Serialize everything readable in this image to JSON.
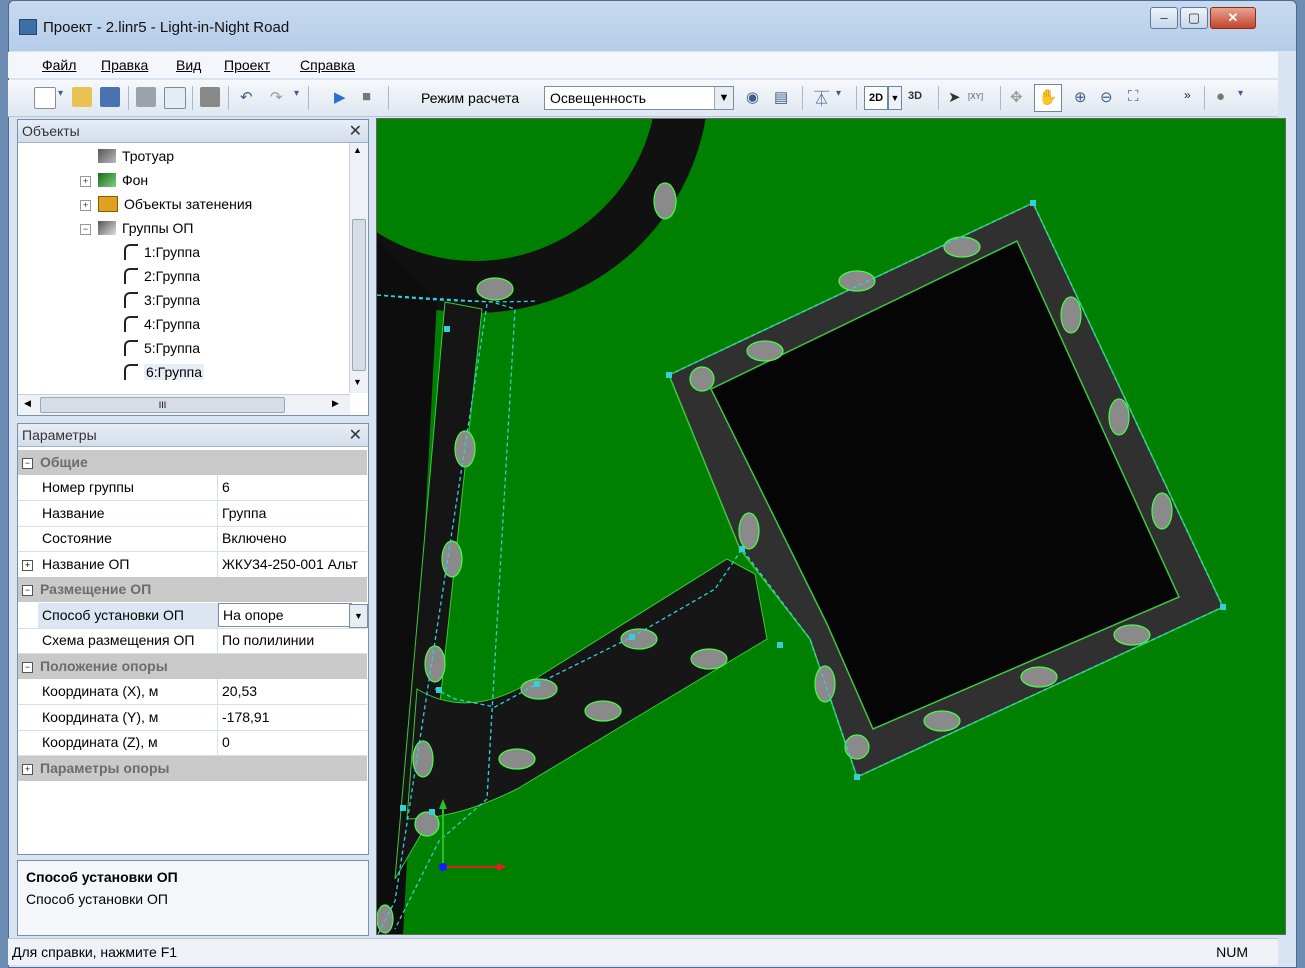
{
  "window": {
    "title": "Проект - 2.linr5 - Light-in-Night Road",
    "min": "–",
    "max": "▢",
    "close": "✕"
  },
  "menu": [
    "Файл",
    "Правка",
    "Вид",
    "Проект",
    "Справка"
  ],
  "toolbar": {
    "mode_label": "Режим расчета",
    "mode_value": "Освещенность",
    "btn_2d": "2D",
    "btn_3d": "3D",
    "xy_label": "[XY]"
  },
  "objects_pane": {
    "title": "Объекты",
    "close": "✕",
    "items": [
      {
        "label": "Тротуар",
        "icon": "sidewalk-icon"
      },
      {
        "label": "Фон",
        "icon": "background-icon"
      },
      {
        "label": "Объекты затенения",
        "icon": "shading-objects-icon"
      },
      {
        "label": "Группы ОП",
        "icon": "pole-groups-icon"
      },
      {
        "label": "1:Группа",
        "icon": "lamp-pole-icon"
      },
      {
        "label": "2:Группа",
        "icon": "lamp-pole-icon"
      },
      {
        "label": "3:Группа",
        "icon": "lamp-pole-icon"
      },
      {
        "label": "4:Группа",
        "icon": "lamp-pole-icon"
      },
      {
        "label": "5:Группа",
        "icon": "lamp-pole-icon"
      },
      {
        "label": "6:Группа",
        "icon": "lamp-pole-icon"
      }
    ],
    "hscroll_grip": "III"
  },
  "params_pane": {
    "title": "Параметры",
    "close": "✕",
    "cat_general": "Общие",
    "group_number": {
      "key": "Номер группы",
      "value": "6"
    },
    "name": {
      "key": "Название",
      "value": "Группа"
    },
    "state": {
      "key": "Состояние",
      "value": "Включено"
    },
    "lamp_name": {
      "key": "Название ОП",
      "value": "ЖКУ34-250-001 Альт"
    },
    "cat_placement": "Размещение ОП",
    "install_method": {
      "key": "Способ установки ОП",
      "value": "На опоре"
    },
    "layout_scheme": {
      "key": "Схема размещения ОП",
      "value": "По полилинии"
    },
    "cat_position": "Положение опоры",
    "coord_x": {
      "key": "Координата (X), м",
      "value": "20,53"
    },
    "coord_y": {
      "key": "Координата (Y), м",
      "value": "-178,91"
    },
    "coord_z": {
      "key": "Координата (Z), м",
      "value": "0"
    },
    "cat_pole_params": "Параметры опоры"
  },
  "help": {
    "title": "Способ установки ОП",
    "text": "Способ установки ОП"
  },
  "status": {
    "text": "Для справки, нажмите F1",
    "num": "NUM"
  },
  "colors": {
    "ground": "#008000",
    "road": "#0a0a0a",
    "contour": "#44ff44",
    "selection": "#33d0d8"
  }
}
